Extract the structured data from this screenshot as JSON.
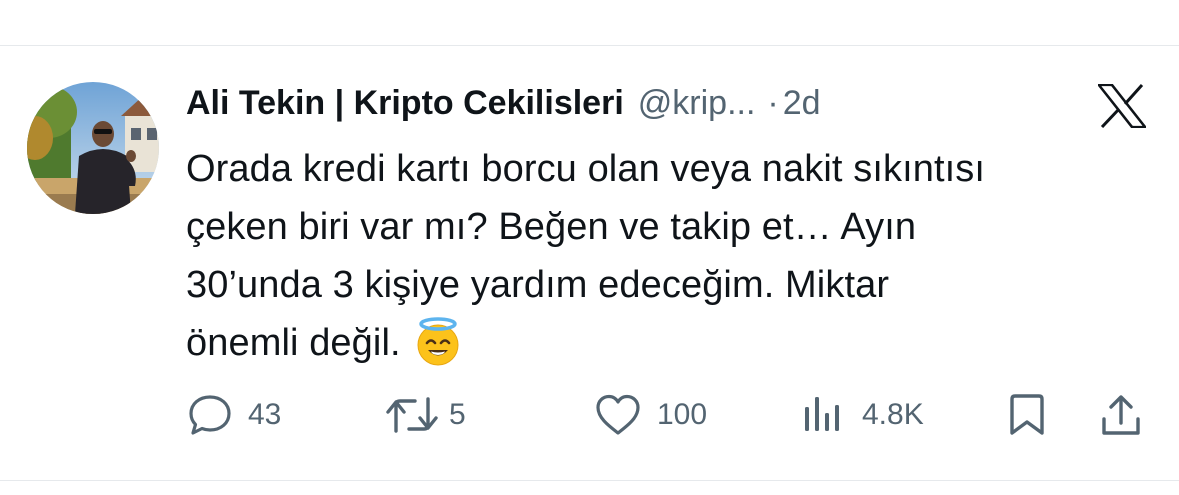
{
  "tweet": {
    "author": {
      "display_name": "Ali Tekin | Kripto Cekilisleri",
      "handle": "@krip...",
      "avatar": "profile-photo"
    },
    "separator": "·",
    "time": "2d",
    "brand_icon": "x-logo-icon",
    "text_lines": [
      "Orada kredi kartı borcu olan veya nakit sıkıntısı",
      "çeken biri var mı? Beğen ve takip et… Ayın",
      "30’unda 3 kişiye yardım edeceğim. Miktar",
      "önemli değil."
    ],
    "emoji": "smiling-face-with-halo"
  },
  "actions": {
    "reply": {
      "icon": "reply-icon",
      "count": "43"
    },
    "repost": {
      "icon": "repost-icon",
      "count": "5"
    },
    "like": {
      "icon": "heart-icon",
      "count": "100"
    },
    "views": {
      "icon": "views-chart-icon",
      "count": "4.8K"
    },
    "bookmark": {
      "icon": "bookmark-icon"
    },
    "share": {
      "icon": "share-icon"
    }
  },
  "colors": {
    "text_primary": "#0f1419",
    "text_secondary": "#536471",
    "divider": "#e6e9ec",
    "background": "#ffffff"
  }
}
